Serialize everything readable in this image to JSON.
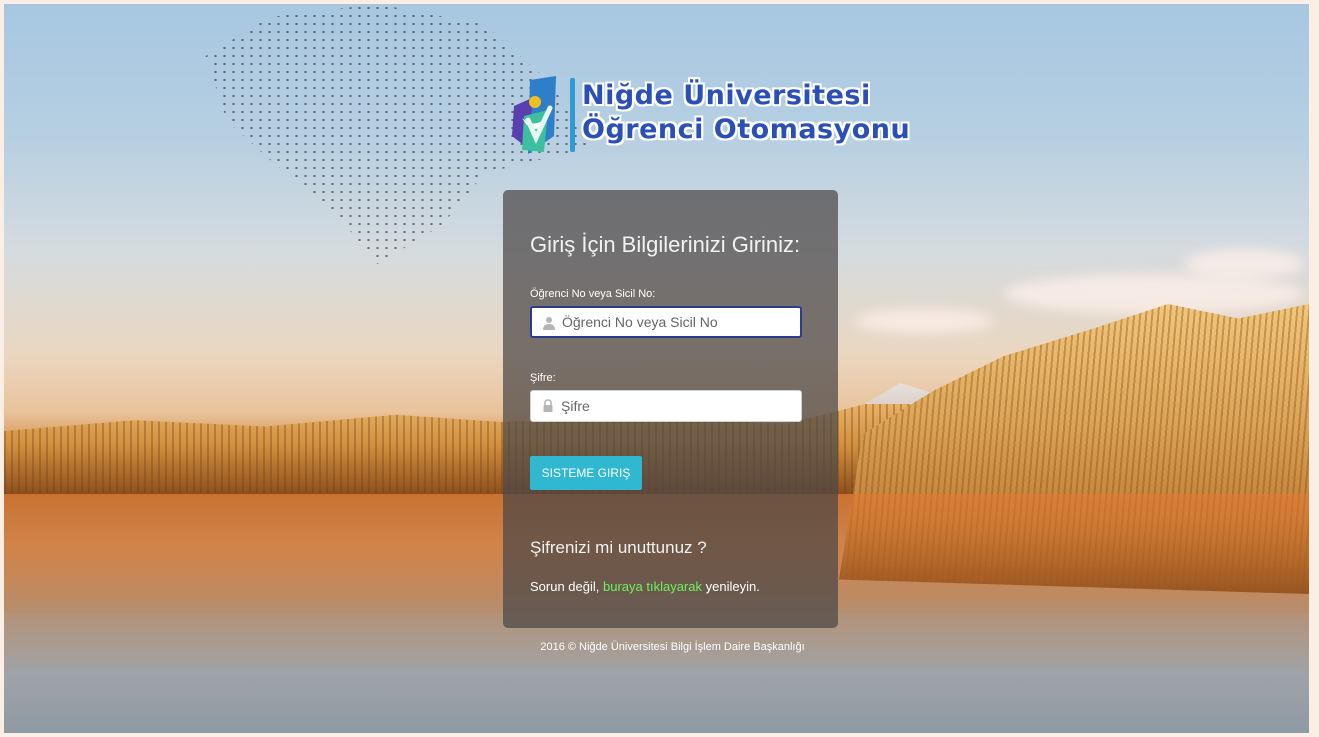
{
  "logo": {
    "line1": "Niğde Üniversitesi",
    "line2": "Öğrenci Otomasyonu",
    "mark_icon": "university-emblem-icon"
  },
  "login": {
    "heading": "Giriş İçin Bilgilerinizi Giriniz:",
    "username_label": "Öğrenci No veya Sicil No:",
    "username_placeholder": "Öğrenci No veya Sicil No",
    "username_value": "",
    "username_icon": "user-icon",
    "password_label": "Şifre:",
    "password_placeholder": "Şifre",
    "password_value": "",
    "password_icon": "lock-icon",
    "submit_label": "SISTEME GIRIŞ"
  },
  "forgot": {
    "title": "Şifrenizi mi unuttunuz ?",
    "prefix": "Sorun değil, ",
    "link": "buraya tıklayarak",
    "suffix": " yenileyin."
  },
  "footer": {
    "text": "2016 © Niğde Üniversitesi Bilgi İşlem Daire Başkanlığı"
  },
  "colors": {
    "panel_bg": "#4b4646",
    "button": "#2fb8d0",
    "link": "#6cf25a",
    "logo_text": "#2a4fb8",
    "logo_divider": "#2f9bd6"
  }
}
